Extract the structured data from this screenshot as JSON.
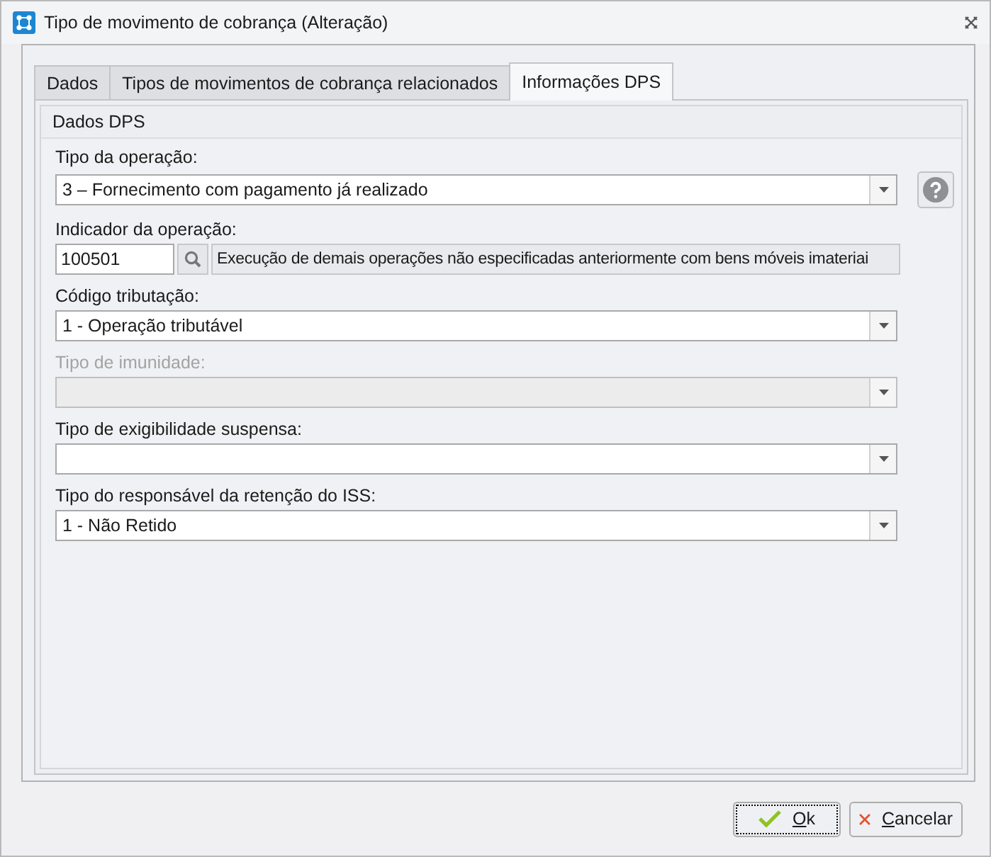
{
  "window": {
    "title": "Tipo de movimento de cobrança (Alteração)"
  },
  "tabs": [
    {
      "label": "Dados",
      "selected": false
    },
    {
      "label": "Tipos de movimentos de cobrança relacionados",
      "selected": false
    },
    {
      "label": "Informações DPS",
      "selected": true
    }
  ],
  "section": {
    "title": "Dados DPS"
  },
  "fields": [
    {
      "kind": "select",
      "label": "Tipo da operação:",
      "value": "3 – Fornecimento com pagamento já realizado",
      "disabled": false,
      "help": true
    },
    {
      "kind": "lookup",
      "label": "Indicador da operação:",
      "value": "100501",
      "description": "Execução de demais operações não especificadas anteriormente com bens móveis imateriai",
      "disabled": false,
      "help": false
    },
    {
      "kind": "select",
      "label": "Código tributação:",
      "value": "1 - Operação tributável",
      "disabled": false,
      "help": false
    },
    {
      "kind": "select",
      "label": "Tipo de imunidade:",
      "disabled": true,
      "help": false
    },
    {
      "kind": "select",
      "label": "Tipo de exigibilidade suspensa:",
      "disabled": false,
      "help": false
    },
    {
      "kind": "select",
      "label": "Tipo do responsável da retenção do ISS:",
      "value": "1 - Não Retido",
      "disabled": false,
      "help": false
    }
  ],
  "buttons": [
    {
      "kind": "ok",
      "label": "Ok",
      "focused": true
    },
    {
      "kind": "cancel",
      "label": "Cancelar",
      "focused": false
    }
  ]
}
